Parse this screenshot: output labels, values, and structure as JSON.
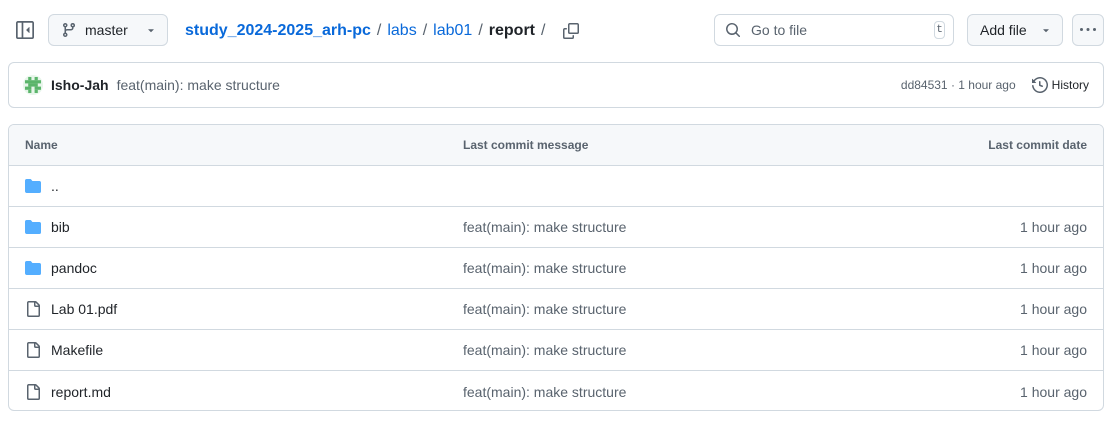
{
  "header": {
    "branch": "master",
    "breadcrumb": {
      "repo": "study_2024-2025_arh-pc",
      "sep": "/",
      "path1": "labs",
      "path2": "lab01",
      "current": "report"
    },
    "search": {
      "placeholder": "Go to file",
      "shortcut": "t"
    },
    "add_file_label": "Add file"
  },
  "commit": {
    "author": "Isho-Jah",
    "message": "feat(main): make structure",
    "sha_time": "dd84531 · 1 hour ago",
    "history_label": "History"
  },
  "table": {
    "headers": {
      "name": "Name",
      "message": "Last commit message",
      "date": "Last commit date"
    },
    "rows": [
      {
        "type": "folder",
        "name": "..",
        "message": "",
        "date": ""
      },
      {
        "type": "folder",
        "name": "bib",
        "message": "feat(main): make structure",
        "date": "1 hour ago"
      },
      {
        "type": "folder",
        "name": "pandoc",
        "message": "feat(main): make structure",
        "date": "1 hour ago"
      },
      {
        "type": "file",
        "name": "Lab 01.pdf",
        "message": "feat(main): make structure",
        "date": "1 hour ago"
      },
      {
        "type": "file",
        "name": "Makefile",
        "message": "feat(main): make structure",
        "date": "1 hour ago"
      },
      {
        "type": "file",
        "name": "report.md",
        "message": "feat(main): make structure",
        "date": "1 hour ago"
      }
    ]
  },
  "colors": {
    "link": "#0969da",
    "folder": "#54aeff",
    "muted": "#59636e",
    "border": "#d1d9e0"
  }
}
